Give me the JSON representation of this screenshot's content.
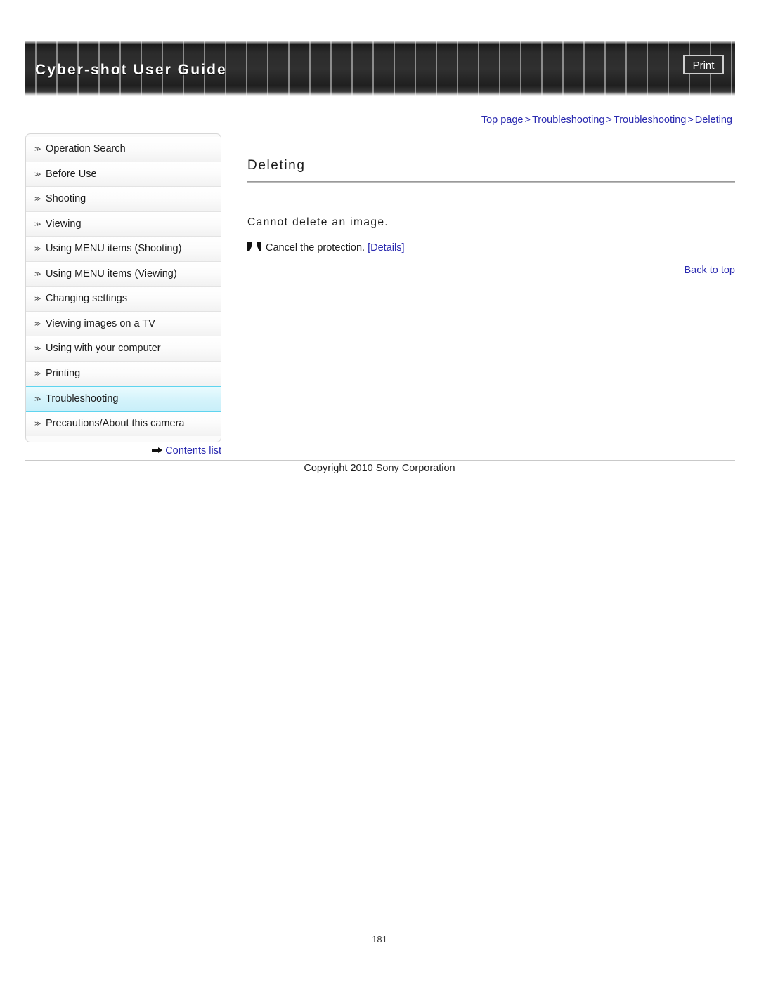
{
  "header": {
    "title": "Cyber-shot User Guide",
    "print_label": "Print"
  },
  "breadcrumb": {
    "items": [
      {
        "label": "Top page"
      },
      {
        "label": "Troubleshooting"
      },
      {
        "label": "Troubleshooting"
      },
      {
        "label": "Deleting"
      }
    ],
    "separator": ">"
  },
  "sidebar": {
    "bullet_glyph": "≫",
    "items": [
      {
        "label": "Operation Search",
        "active": false
      },
      {
        "label": "Before Use",
        "active": false
      },
      {
        "label": "Shooting",
        "active": false
      },
      {
        "label": "Viewing",
        "active": false
      },
      {
        "label": "Using MENU items (Shooting)",
        "active": false
      },
      {
        "label": "Using MENU items (Viewing)",
        "active": false
      },
      {
        "label": "Changing settings",
        "active": false
      },
      {
        "label": "Viewing images on a TV",
        "active": false
      },
      {
        "label": "Using with your computer",
        "active": false
      },
      {
        "label": "Printing",
        "active": false
      },
      {
        "label": "Troubleshooting",
        "active": true
      },
      {
        "label": "Precautions/About this camera",
        "active": false
      }
    ],
    "contents_list_label": "Contents list"
  },
  "main": {
    "page_heading": "Deleting",
    "section_title": "Cannot delete an image.",
    "item_text": "Cancel the protection.",
    "details_label": "[Details]",
    "back_to_top_label": "Back to top"
  },
  "footer": {
    "copyright": "Copyright 2010 Sony Corporation",
    "page_number": "181"
  },
  "colors": {
    "link": "#2a2ab0",
    "active_nav_bg": "#d4f3fb",
    "active_nav_border": "#5fd4ef",
    "header_dark": "#2e2e2e"
  }
}
